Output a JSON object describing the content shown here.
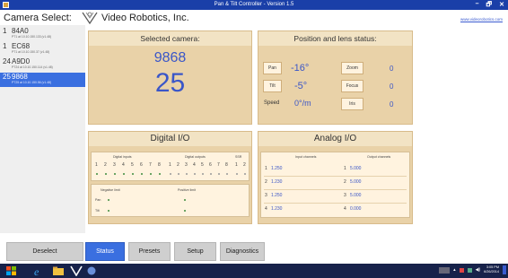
{
  "window": {
    "title": "Pan & Tilt Controller - Version 1.5",
    "controls": [
      "–",
      "🗗",
      "✕"
    ]
  },
  "header": {
    "camera_select_label": "Camera Select:",
    "company": "Video Robotics, Inc.",
    "url": "www.videorobotics.com"
  },
  "cameras": [
    {
      "number": "1",
      "name": "84A0",
      "ip": "PT1 at 10.10.150.133 (v1.48)",
      "selected": false
    },
    {
      "number": "1",
      "name": "EC68",
      "ip": "PT1 at 10.10.150.37 (v1.48)",
      "selected": false
    },
    {
      "number": "24",
      "name": "A9D0",
      "ip": "PT24 at 10.10.150.114 (v1.48)",
      "selected": false
    },
    {
      "number": "25",
      "name": "9868",
      "ip": "PT25 at 10.10.150.56 (v1.48)",
      "selected": true
    }
  ],
  "selected_camera": {
    "heading": "Selected camera:",
    "name": "9868",
    "number": "25"
  },
  "position": {
    "heading": "Position and lens status:",
    "pan_button": "Pan",
    "pan_value": "-16°",
    "tilt_button": "Tilt",
    "tilt_value": "-5°",
    "speed_label": "Speed",
    "speed_value": "0°/m",
    "zoom_button": "Zoom",
    "zoom_value": "0",
    "focus_button": "Focus",
    "focus_value": "0",
    "iris_button": "Iris",
    "iris_value": "0"
  },
  "digital_io": {
    "heading": "Digital I/O",
    "inputs_label": "Digital inputs",
    "outputs_label": "Digital outputs",
    "ssr_label": "SSR",
    "input_numbers": [
      "1",
      "2",
      "3",
      "4",
      "5",
      "6",
      "7",
      "8"
    ],
    "output_numbers": [
      "1",
      "2",
      "3",
      "4",
      "5",
      "6",
      "7",
      "8"
    ],
    "ssr_numbers": [
      "1",
      "2"
    ],
    "negative_limit_label": "Negative limit",
    "positive_limit_label": "Positive limit",
    "pan_label": "Pan",
    "tilt_label": "Tilt"
  },
  "analog_io": {
    "heading": "Analog I/O",
    "input_label": "Input channels",
    "output_label": "Output channels",
    "inputs": [
      {
        "ch": "1",
        "value": "1.250"
      },
      {
        "ch": "2",
        "value": "1.230"
      },
      {
        "ch": "3",
        "value": "1.250"
      },
      {
        "ch": "4",
        "value": "1.230"
      }
    ],
    "outputs": [
      {
        "ch": "1",
        "value": "5.000"
      },
      {
        "ch": "2",
        "value": "5.000"
      },
      {
        "ch": "3",
        "value": "5.000"
      },
      {
        "ch": "4",
        "value": "0.000"
      }
    ]
  },
  "buttons": {
    "deselect": "Deselect",
    "status": "Status",
    "presets": "Presets",
    "setup": "Setup",
    "diagnostics": "Diagnostics"
  },
  "taskbar": {
    "time": "3:05 PM",
    "date": "6/26/2014"
  },
  "colors": {
    "accent": "#3a6fe0",
    "panel": "#e9d2a8",
    "value_text": "#3a56c8",
    "titlebar": "#1a3fa8"
  }
}
